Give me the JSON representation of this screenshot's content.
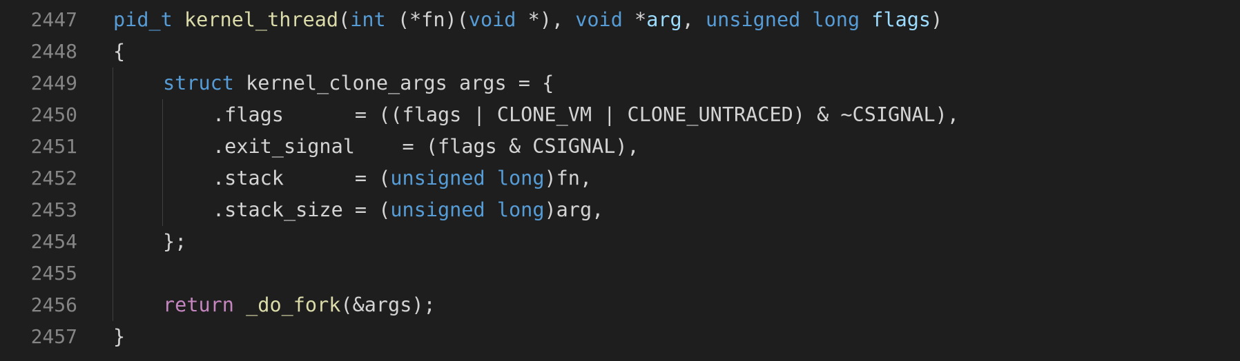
{
  "editor": {
    "lines": [
      {
        "number": "2447",
        "indent": 0,
        "tokens": [
          {
            "text": "pid_t",
            "kind": "kw"
          },
          {
            "text": " ",
            "kind": "plain"
          },
          {
            "text": "kernel_thread",
            "kind": "func"
          },
          {
            "text": "(",
            "kind": "punct"
          },
          {
            "text": "int",
            "kind": "kw"
          },
          {
            "text": " (*fn)(",
            "kind": "plain"
          },
          {
            "text": "void",
            "kind": "kw"
          },
          {
            "text": " *), ",
            "kind": "plain"
          },
          {
            "text": "void",
            "kind": "kw"
          },
          {
            "text": " *",
            "kind": "plain"
          },
          {
            "text": "arg",
            "kind": "param"
          },
          {
            "text": ", ",
            "kind": "plain"
          },
          {
            "text": "unsigned",
            "kind": "kw"
          },
          {
            "text": " ",
            "kind": "plain"
          },
          {
            "text": "long",
            "kind": "kw"
          },
          {
            "text": " ",
            "kind": "plain"
          },
          {
            "text": "flags",
            "kind": "param"
          },
          {
            "text": ")",
            "kind": "punct"
          }
        ]
      },
      {
        "number": "2448",
        "indent": 0,
        "tokens": [
          {
            "text": "{",
            "kind": "punct"
          }
        ]
      },
      {
        "number": "2449",
        "indent": 1,
        "tokens": [
          {
            "text": "struct",
            "kind": "kw"
          },
          {
            "text": " kernel_clone_args args = {",
            "kind": "plain"
          }
        ]
      },
      {
        "number": "2450",
        "indent": 2,
        "tokens": [
          {
            "text": ".flags      = ((flags | CLONE_VM | CLONE_UNTRACED) & ~CSIGNAL),",
            "kind": "plain"
          }
        ]
      },
      {
        "number": "2451",
        "indent": 2,
        "tokens": [
          {
            "text": ".exit_signal    = (flags & CSIGNAL),",
            "kind": "plain"
          }
        ]
      },
      {
        "number": "2452",
        "indent": 2,
        "tokens": [
          {
            "text": ".stack      = (",
            "kind": "plain"
          },
          {
            "text": "unsigned",
            "kind": "kw"
          },
          {
            "text": " ",
            "kind": "plain"
          },
          {
            "text": "long",
            "kind": "kw"
          },
          {
            "text": ")fn,",
            "kind": "plain"
          }
        ]
      },
      {
        "number": "2453",
        "indent": 2,
        "tokens": [
          {
            "text": ".stack_size = (",
            "kind": "plain"
          },
          {
            "text": "unsigned",
            "kind": "kw"
          },
          {
            "text": " ",
            "kind": "plain"
          },
          {
            "text": "long",
            "kind": "kw"
          },
          {
            "text": ")arg,",
            "kind": "plain"
          }
        ]
      },
      {
        "number": "2454",
        "indent": 1,
        "tokens": [
          {
            "text": "};",
            "kind": "plain"
          }
        ]
      },
      {
        "number": "2455",
        "indent": 0,
        "tokens": []
      },
      {
        "number": "2456",
        "indent": 1,
        "tokens": [
          {
            "text": "return",
            "kind": "ctrl"
          },
          {
            "text": " ",
            "kind": "plain"
          },
          {
            "text": "_do_fork",
            "kind": "func"
          },
          {
            "text": "(&args);",
            "kind": "plain"
          }
        ]
      },
      {
        "number": "2457",
        "indent": 0,
        "tokens": [
          {
            "text": "}",
            "kind": "punct"
          }
        ]
      }
    ]
  },
  "theme": {
    "background": "#1e1e1e",
    "line_number": "#858585",
    "keyword": "#569cd6",
    "function": "#dcdcaa",
    "parameter": "#9cdcfe",
    "control": "#c586c0",
    "text": "#d4d4d4",
    "indent_guide": "#404040"
  }
}
